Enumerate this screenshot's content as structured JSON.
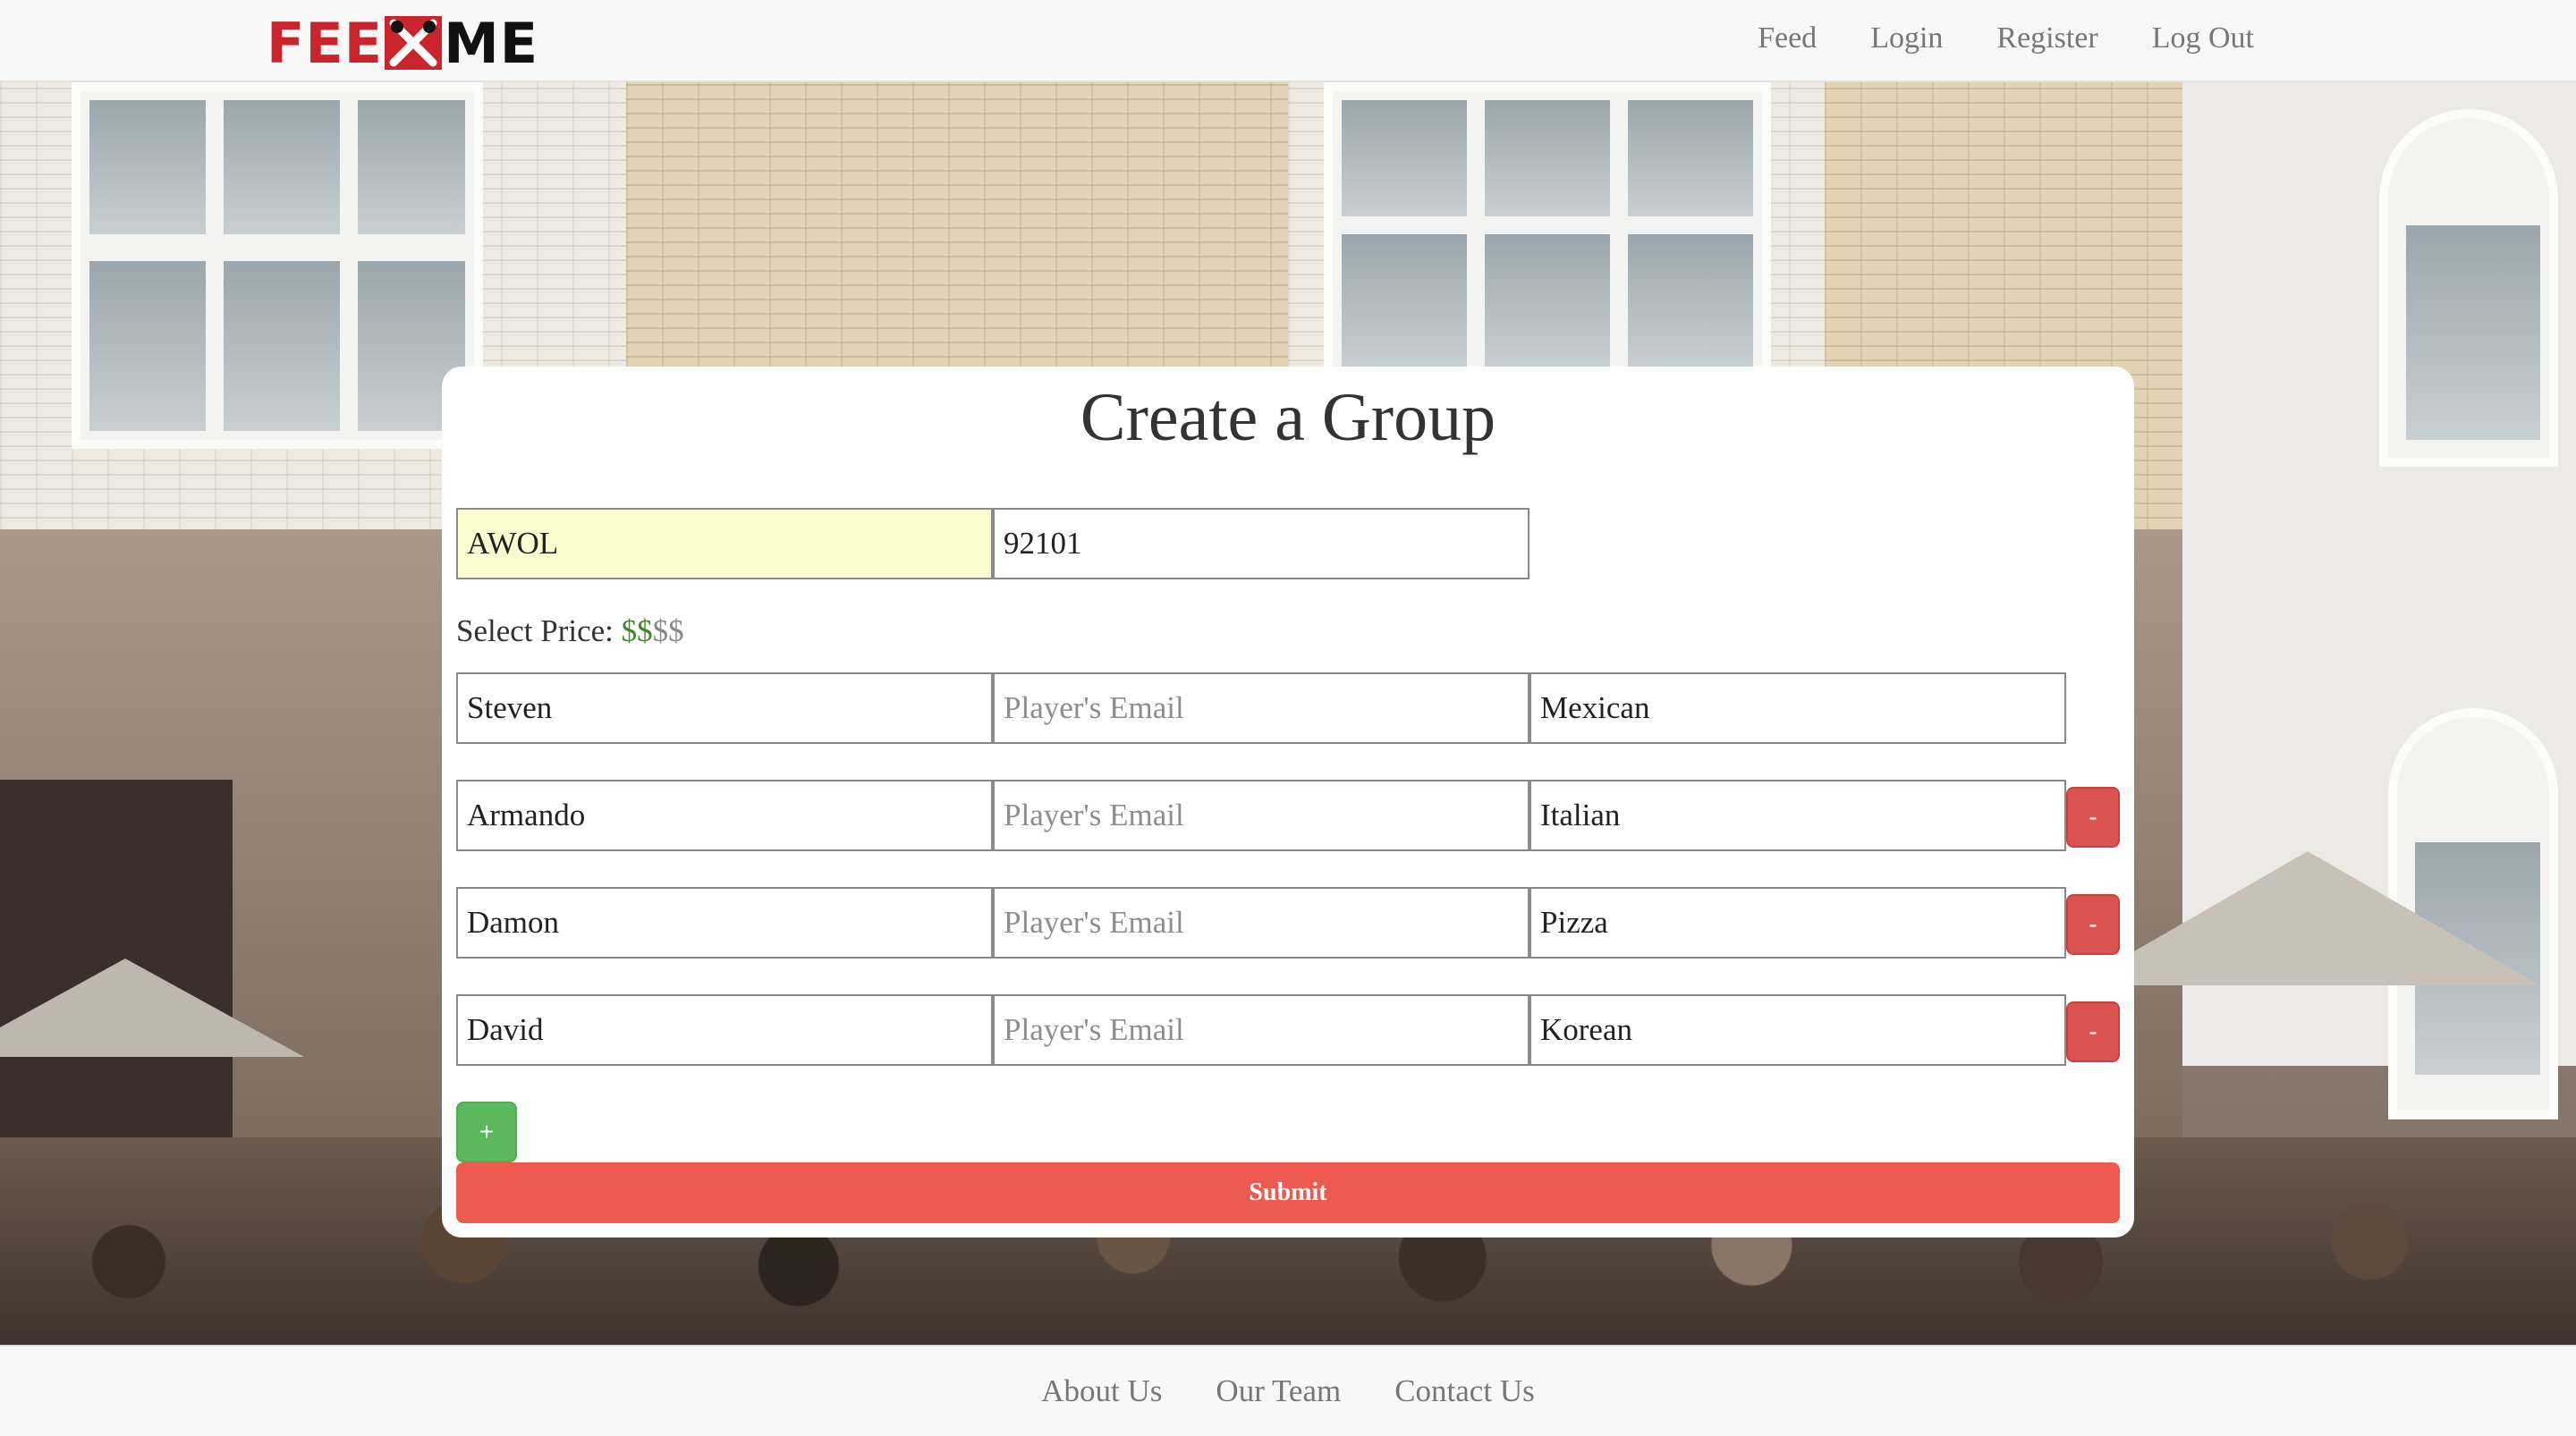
{
  "navbar": {
    "logo": {
      "left": "FEE",
      "right": "ME",
      "icon": "crossed-utensils-icon"
    },
    "links": [
      "Feed",
      "Login",
      "Register",
      "Log Out"
    ]
  },
  "form": {
    "title": "Create a Group",
    "group_name": {
      "value": "AWOL"
    },
    "zip": {
      "value": "92101"
    },
    "price": {
      "label": "Select Price:",
      "selected": "$$",
      "unselected": "$$",
      "level": 2,
      "max": 4
    },
    "players": [
      {
        "name": "Steven",
        "email_placeholder": "Player's Email",
        "email": "",
        "cuisine": "Mexican",
        "removable": false
      },
      {
        "name": "Armando",
        "email_placeholder": "Player's Email",
        "email": "",
        "cuisine": "Italian",
        "removable": true
      },
      {
        "name": "Damon",
        "email_placeholder": "Player's Email",
        "email": "",
        "cuisine": "Pizza",
        "removable": true
      },
      {
        "name": "David",
        "email_placeholder": "Player's Email",
        "email": "",
        "cuisine": "Korean",
        "removable": true
      }
    ],
    "remove_label": "-",
    "add_label": "+",
    "submit_label": "Submit"
  },
  "footer": {
    "links": [
      "About Us",
      "Our Team",
      "Contact Us"
    ]
  },
  "colors": {
    "brand_red": "#c9252c",
    "submit": "#ee5a50",
    "remove": "#d9534f",
    "add": "#5cb85c",
    "price_selected": "#3d8a2b",
    "autofill": "#fafcd0"
  }
}
